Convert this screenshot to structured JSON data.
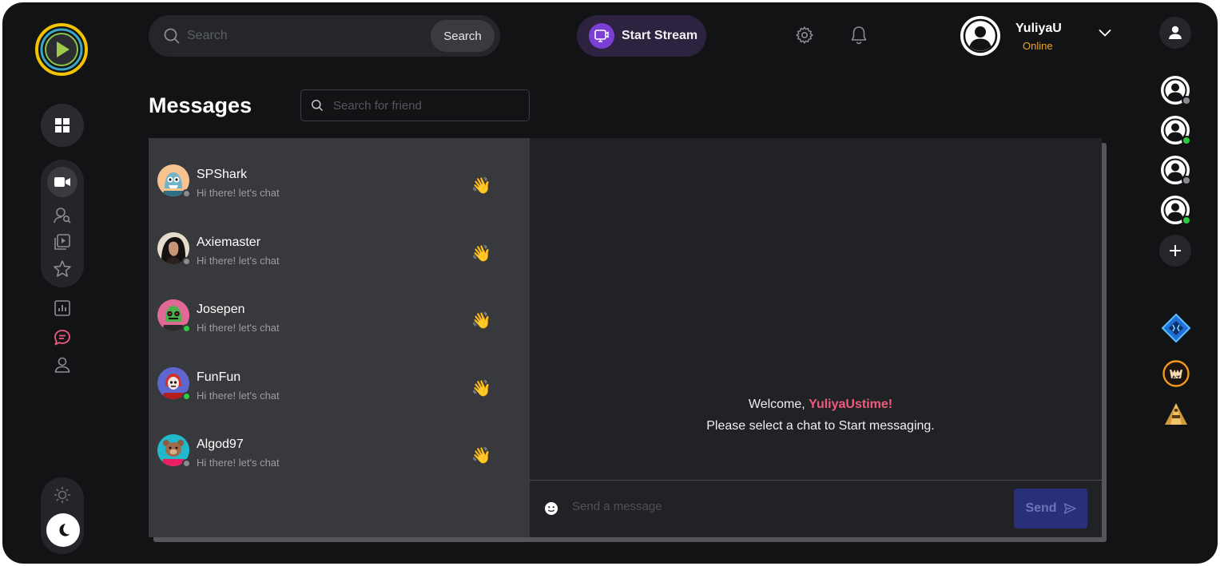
{
  "header": {
    "search_placeholder": "Search",
    "search_button": "Search",
    "stream_button": "Start Stream",
    "user": {
      "name": "YuliyaU",
      "status": "Online"
    }
  },
  "messages": {
    "title": "Messages",
    "friend_search_placeholder": "Search for friend",
    "chats": [
      {
        "name": "SPShark",
        "preview": "Hi there! let's chat",
        "online": false
      },
      {
        "name": "Axiemaster",
        "preview": "Hi there! let's chat",
        "online": false
      },
      {
        "name": "Josepen",
        "preview": "Hi there! let's chat",
        "online": true
      },
      {
        "name": "FunFun",
        "preview": "Hi there! let's chat",
        "online": true
      },
      {
        "name": "Algod97",
        "preview": "Hi there! let's chat",
        "online": false
      }
    ],
    "welcome_prefix": "Welcome, ",
    "welcome_name": "YuliyaUstime!",
    "welcome_sub": "Please select a chat to Start messaging.",
    "composer_placeholder": "Send a message",
    "send_button": "Send"
  },
  "colors": {
    "background": "#121315",
    "accent_pink": "#ef5b7e",
    "status_online": "#2ecc40",
    "status_offline": "#8a8b90",
    "user_status": "#f5a623",
    "stream_purple": "#7b3fd4"
  },
  "icons": {
    "left_rail": [
      "dashboard-icon",
      "video-camera-icon",
      "user-search-icon",
      "playlist-icon",
      "star-icon",
      "bar-chart-icon",
      "chat-icon",
      "profile-icon",
      "sun-icon",
      "moon-icon"
    ],
    "right_rail": [
      "user-icon",
      "add-icon",
      "game-diamond-icon",
      "game-monster-icon",
      "game-pyramid-icon"
    ]
  }
}
